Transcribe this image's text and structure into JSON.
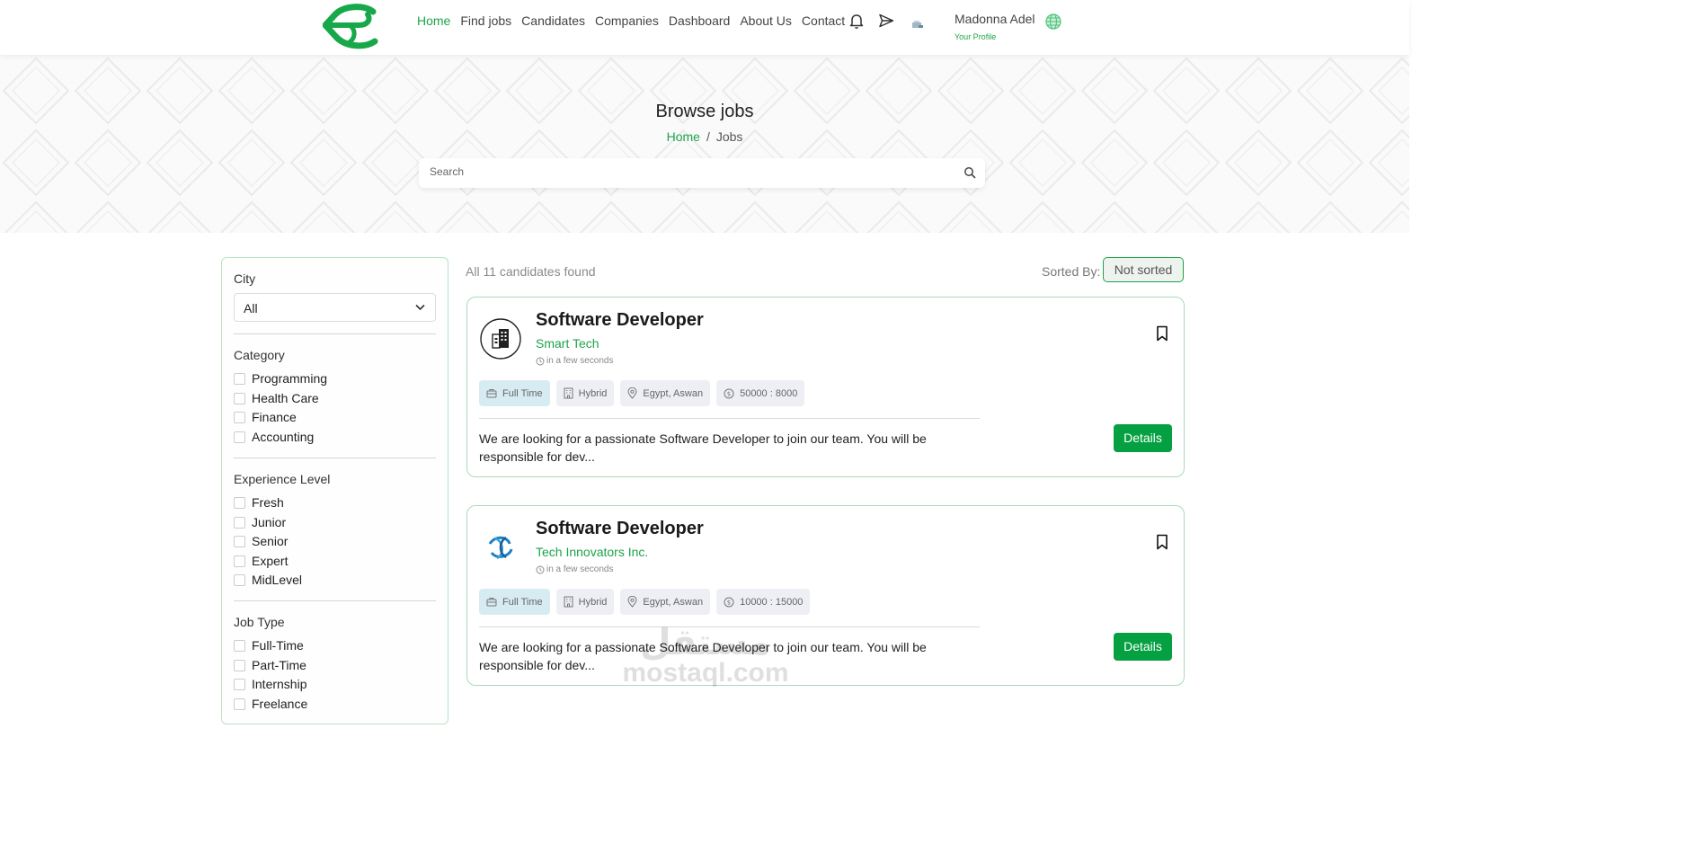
{
  "nav": {
    "links": [
      "Home",
      "Find jobs",
      "Candidates",
      "Companies",
      "Dashboard",
      "About Us",
      "Contact"
    ],
    "active": "Home",
    "user_name": "Madonna Adel",
    "user_profile_label": "Your Profile"
  },
  "hero": {
    "title": "Browse jobs",
    "breadcrumb_home": "Home",
    "breadcrumb_sep": "/",
    "breadcrumb_current": "Jobs",
    "search_placeholder": "Search"
  },
  "filters": {
    "city": {
      "label": "City",
      "selected": "All"
    },
    "category": {
      "label": "Category",
      "options": [
        "Programming",
        "Health Care",
        "Finance",
        "Accounting"
      ]
    },
    "experience": {
      "label": "Experience Level",
      "options": [
        "Fresh",
        "Junior",
        "Senior",
        "Expert",
        "MidLevel"
      ]
    },
    "job_type": {
      "label": "Job Type",
      "options": [
        "Full-Time",
        "Part-Time",
        "Internship",
        "Freelance"
      ]
    }
  },
  "results": {
    "count_text": "All 11 candidates found",
    "sorted_label": "Sorted By:",
    "sorted_value": "Not sorted"
  },
  "jobs": [
    {
      "title": "Software Developer",
      "company": "Smart Tech",
      "posted": "in a few seconds",
      "type": "Full Time",
      "mode": "Hybrid",
      "location": "Egypt, Aswan",
      "salary": "50000 : 8000",
      "description": "We are looking for a passionate Software Developer to join our team. You will be responsible for dev...",
      "details_label": "Details",
      "logo_icon": "building-icon"
    },
    {
      "title": "Software Developer",
      "company": "Tech Innovators Inc.",
      "posted": "in a few seconds",
      "type": "Full Time",
      "mode": "Hybrid",
      "location": "Egypt, Aswan",
      "salary": "10000 : 15000",
      "description": "We are looking for a passionate Software Developer to join our team. You will be responsible for dev...",
      "details_label": "Details",
      "logo_icon": "swirl-logo-icon"
    }
  ],
  "watermark": {
    "arabic": "مستقل",
    "latin": "mostaql.com"
  },
  "colors": {
    "brand_green": "#1ea449",
    "button_green": "#05a041",
    "card_border": "#a9dcbc"
  }
}
